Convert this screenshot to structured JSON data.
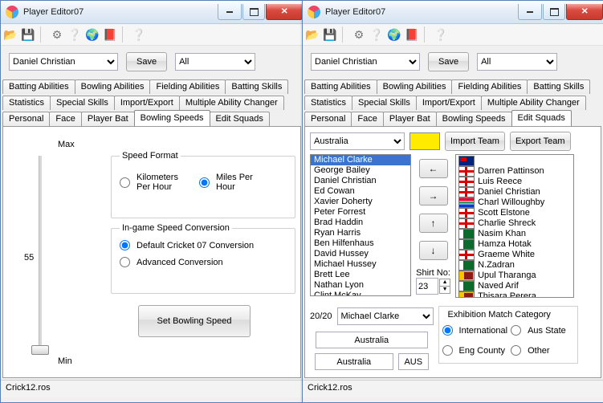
{
  "app_title": "Player Editor07",
  "status_file": "Crick12.ros",
  "icons": [
    "open",
    "save",
    "gear",
    "help",
    "globe",
    "exit",
    "help2"
  ],
  "toprow": {
    "player": "Daniel Christian",
    "save_label": "Save",
    "filter": "All"
  },
  "tabs_row1": [
    "Batting Abilities",
    "Bowling Abilities",
    "Fielding Abilities",
    "Batting Skills"
  ],
  "tabs_row2": [
    "Statistics",
    "Special Skills",
    "Import/Export",
    "Multiple Ability Changer"
  ],
  "tabs_row3": [
    "Personal",
    "Face",
    "Player Bat",
    "Bowling Speeds",
    "Edit Squads"
  ],
  "left_active_tab": "Bowling Speeds",
  "right_active_tab": "Edit Squads",
  "bowling": {
    "slider": {
      "max_label": "Max",
      "min_label": "Min",
      "value_label": "55"
    },
    "speed_format": {
      "legend": "Speed Format",
      "opt_kph": "Kilometers Per Hour",
      "opt_mph": "Miles Per Hour",
      "selected": "mph"
    },
    "conversion": {
      "legend": "In-game Speed Conversion",
      "opt_default": "Default Cricket 07 Conversion",
      "opt_adv": "Advanced Conversion",
      "selected": "default"
    },
    "set_btn": "Set Bowling Speed"
  },
  "squads": {
    "team": "Australia",
    "swatch_color": "#ffeb00",
    "import_btn": "Import Team",
    "export_btn": "Export Team",
    "list": [
      "Michael Clarke",
      "George Bailey",
      "Daniel Christian",
      "Ed Cowan",
      "Xavier Doherty",
      "Peter Forrest",
      "Brad Haddin",
      "Ryan Harris",
      "Ben Hilfenhaus",
      "David Hussey",
      "Michael Hussey",
      "Brett Lee",
      "Nathan Lyon",
      "Clint McKay"
    ],
    "list_selected_index": 0,
    "shirt_label": "Shirt No:",
    "shirt_no": "23",
    "pool": [
      {
        "flag": "aus",
        "name": ""
      },
      {
        "flag": "eng",
        "name": "Darren Pattinson"
      },
      {
        "flag": "eng",
        "name": "Luis Reece"
      },
      {
        "flag": "eng",
        "name": "Daniel Christian"
      },
      {
        "flag": "rsa",
        "name": "Charl Willoughby"
      },
      {
        "flag": "eng",
        "name": "Scott Elstone"
      },
      {
        "flag": "eng",
        "name": "Charlie Shreck"
      },
      {
        "flag": "pak",
        "name": "Nasim Khan"
      },
      {
        "flag": "pak",
        "name": "Hamza Hotak"
      },
      {
        "flag": "eng",
        "name": "Graeme White"
      },
      {
        "flag": "pak",
        "name": "N.Zadran"
      },
      {
        "flag": "sl",
        "name": "Upul Tharanga"
      },
      {
        "flag": "pak",
        "name": "Naved Arif"
      },
      {
        "flag": "sl",
        "name": "Thisara Perera"
      }
    ],
    "t20_label": "20/20",
    "t20_player": "Michael Clarke",
    "team_name_field": "Australia",
    "team_name_field2": "Australia",
    "team_abbr": "AUS",
    "exh_legend": "Exhibition Match Category",
    "exh_opts": {
      "intl": "International",
      "aus": "Aus State",
      "eng": "Eng County",
      "other": "Other"
    },
    "exh_selected": "intl"
  }
}
